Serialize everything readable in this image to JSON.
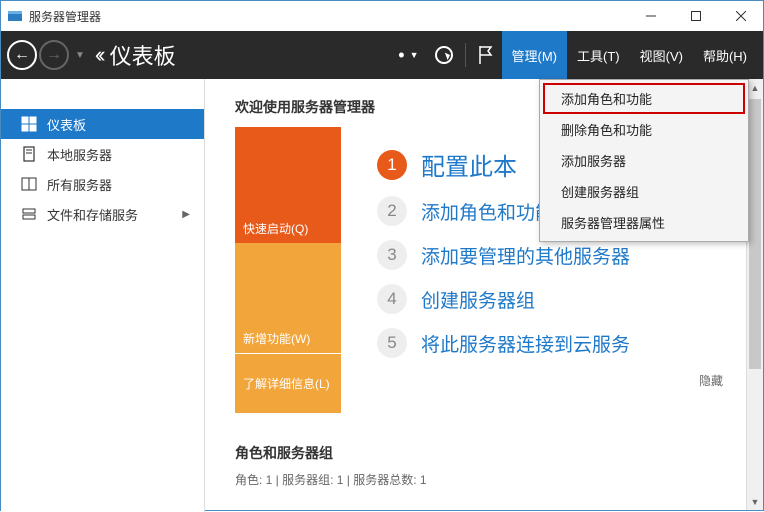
{
  "titlebar": {
    "title": "服务器管理器"
  },
  "toolbar": {
    "page_title": "仪表板",
    "menu": {
      "manage": "管理(M)",
      "tools": "工具(T)",
      "view": "视图(V)",
      "help": "帮助(H)"
    }
  },
  "sidebar": {
    "items": [
      {
        "label": "仪表板",
        "icon": "dashboard-icon"
      },
      {
        "label": "本地服务器",
        "icon": "server-icon"
      },
      {
        "label": "所有服务器",
        "icon": "servers-icon"
      },
      {
        "label": "文件和存储服务",
        "icon": "storage-icon"
      }
    ]
  },
  "main": {
    "welcome_title": "欢迎使用服务器管理器",
    "tiles": {
      "quick_start": "快速启动(Q)",
      "whats_new": "新增功能(W)",
      "learn_more": "了解详细信息(L)"
    },
    "steps": [
      {
        "num": "1",
        "label": "配置此本",
        "primary": true
      },
      {
        "num": "2",
        "label": "添加角色和功能"
      },
      {
        "num": "3",
        "label": "添加要管理的其他服务器"
      },
      {
        "num": "4",
        "label": "创建服务器组"
      },
      {
        "num": "5",
        "label": "将此服务器连接到云服务"
      }
    ],
    "hide": "隐藏",
    "groups_title": "角色和服务器组",
    "groups_sub": "角色: 1 | 服务器组: 1 | 服务器总数: 1"
  },
  "dropdown": {
    "items": [
      "添加角色和功能",
      "删除角色和功能",
      "添加服务器",
      "创建服务器组",
      "服务器管理器属性"
    ]
  }
}
